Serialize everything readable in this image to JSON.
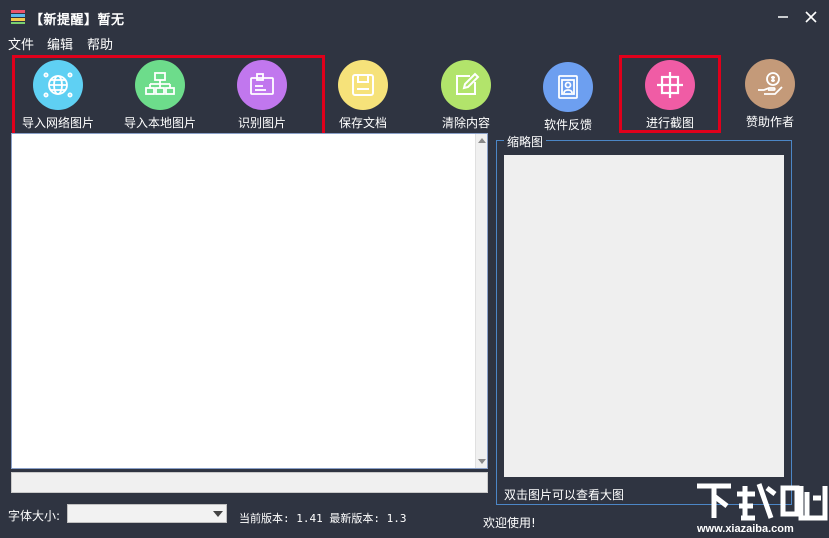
{
  "window": {
    "title": "【新提醒】暂无"
  },
  "menu": {
    "items": [
      "文件",
      "编辑",
      "帮助"
    ]
  },
  "toolbar": {
    "items": [
      {
        "label": "导入网络图片",
        "icon": "globe-network-icon",
        "color": "#5fd0f3"
      },
      {
        "label": "导入本地图片",
        "icon": "local-network-icon",
        "color": "#6ddc8b"
      },
      {
        "label": "识别图片",
        "icon": "id-card-icon",
        "color": "#c177ee"
      },
      {
        "label": "保存文档",
        "icon": "floppy-disk-icon",
        "color": "#f6e27a"
      },
      {
        "label": "清除内容",
        "icon": "edit-icon",
        "color": "#b2e46b"
      },
      {
        "label": "软件反馈",
        "icon": "contact-card-icon",
        "color": "#6d9ff0"
      },
      {
        "label": "进行截图",
        "icon": "crop-grid-icon",
        "color": "#f05ca5"
      },
      {
        "label": "赞助作者",
        "icon": "donate-hand-icon",
        "color": "#c49a79"
      }
    ]
  },
  "thumbnail": {
    "title": "缩略图",
    "caption": "双击图片可以查看大图"
  },
  "footer": {
    "font_size_label": "字体大小:",
    "font_size_value": "",
    "version_text": "当前版本: 1.41 最新版本: 1.3",
    "welcome": "欢迎使用!"
  },
  "watermark": {
    "text": "下载吧",
    "url": "www.xiazaiba.com"
  },
  "colors": {
    "background": "#2f3441",
    "highlight": "#e0001b",
    "group_border": "#4c86c6"
  }
}
